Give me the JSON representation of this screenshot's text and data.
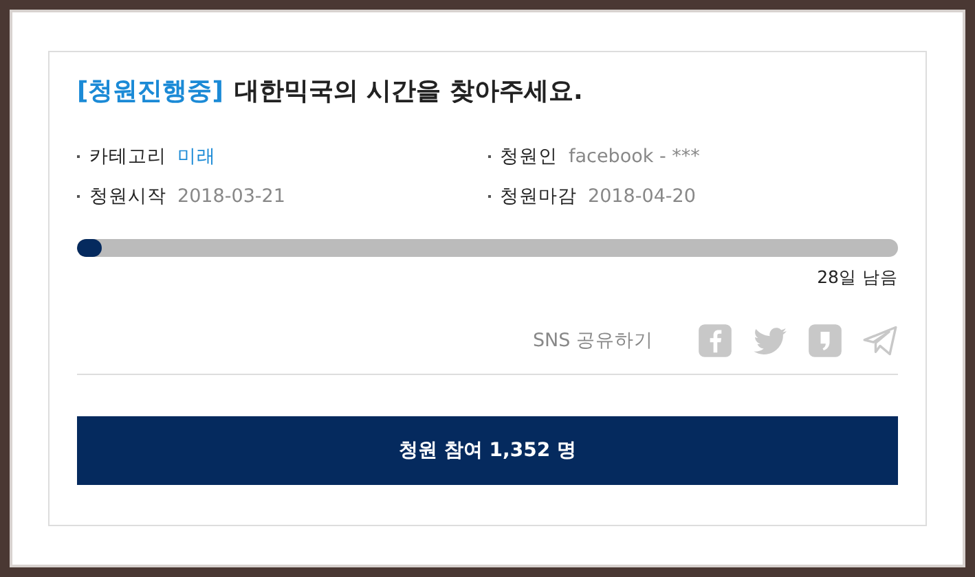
{
  "petition": {
    "status": "[청원진행중]",
    "title": "대한믹국의 시간을 찾아주세요.",
    "meta": [
      {
        "label": "카테고리",
        "value": "미래",
        "kind": "link"
      },
      {
        "label": "청원인",
        "value": "facebook - ***",
        "kind": "plain"
      },
      {
        "label": "청원시작",
        "value": "2018-03-21",
        "kind": "plain"
      },
      {
        "label": "청원마감",
        "value": "2018-04-20",
        "kind": "plain"
      }
    ],
    "progress": {
      "level": 0.03,
      "remaining": "28일 남음"
    },
    "share": {
      "label": "SNS 공유하기",
      "icons": [
        {
          "kind": "facebook"
        },
        {
          "kind": "twitter"
        },
        {
          "kind": "story"
        },
        {
          "kind": "telegram"
        }
      ]
    },
    "join_button": "청원 참여 1,352 명"
  }
}
